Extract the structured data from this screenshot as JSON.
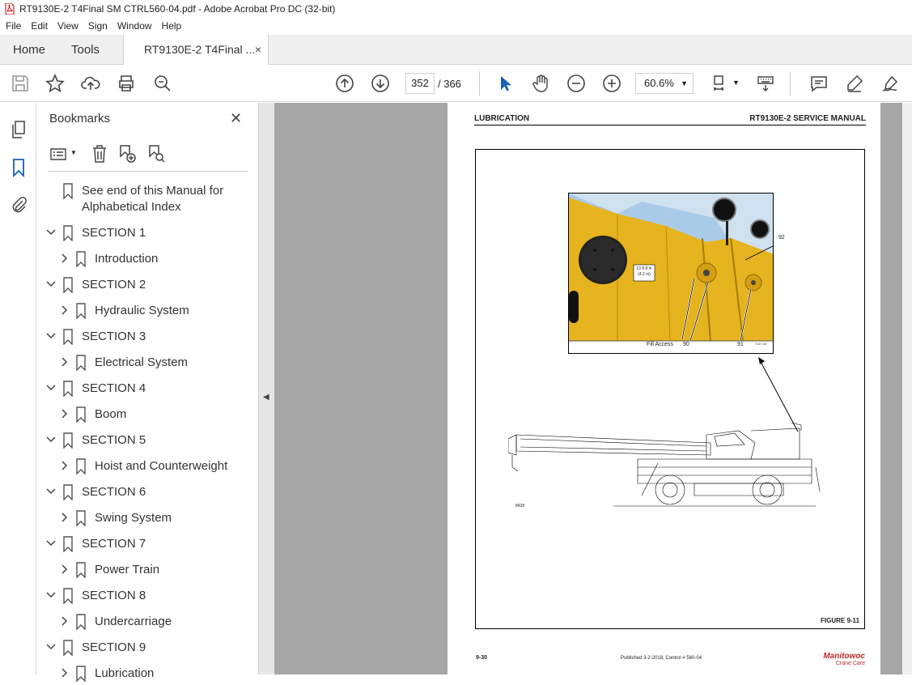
{
  "window": {
    "title": "RT9130E-2 T4Final SM CTRL560-04.pdf - Adobe Acrobat Pro DC (32-bit)"
  },
  "menu": [
    "File",
    "Edit",
    "View",
    "Sign",
    "Window",
    "Help"
  ],
  "tabs": {
    "home": "Home",
    "tools": "Tools",
    "doc": "RT9130E-2 T4Final ...",
    "close": "×"
  },
  "nav": {
    "page": "352",
    "total": "/ 366",
    "zoom": "60.6%"
  },
  "bookmarks": {
    "title": "Bookmarks",
    "items": [
      {
        "label": "See end of this Manual for",
        "label2": "Alphabetical Index",
        "level": 0,
        "chev": "none"
      },
      {
        "label": "SECTION 1",
        "level": 0,
        "chev": "down"
      },
      {
        "label": "Introduction",
        "level": 1,
        "chev": "right"
      },
      {
        "label": "SECTION 2",
        "level": 0,
        "chev": "down"
      },
      {
        "label": "Hydraulic System",
        "level": 1,
        "chev": "right"
      },
      {
        "label": "SECTION 3",
        "level": 0,
        "chev": "down"
      },
      {
        "label": "Electrical System",
        "level": 1,
        "chev": "right"
      },
      {
        "label": "SECTION 4",
        "level": 0,
        "chev": "down"
      },
      {
        "label": "Boom",
        "level": 1,
        "chev": "right"
      },
      {
        "label": "SECTION 5",
        "level": 0,
        "chev": "down"
      },
      {
        "label": "Hoist and Counterweight",
        "level": 1,
        "chev": "right"
      },
      {
        "label": "SECTION 6",
        "level": 0,
        "chev": "down"
      },
      {
        "label": "Swing System",
        "level": 1,
        "chev": "right"
      },
      {
        "label": "SECTION 7",
        "level": 0,
        "chev": "down"
      },
      {
        "label": "Power Train",
        "level": 1,
        "chev": "right"
      },
      {
        "label": "SECTION 8",
        "level": 0,
        "chev": "down"
      },
      {
        "label": "Undercarriage",
        "level": 1,
        "chev": "right"
      },
      {
        "label": "SECTION 9",
        "level": 0,
        "chev": "down"
      },
      {
        "label": "Lubrication",
        "level": 1,
        "chev": "right"
      }
    ]
  },
  "pdfpage": {
    "header_left": "LUBRICATION",
    "header_right": "RT9130E-2 SERVICE MANUAL",
    "measure1": "13 ft 8 in",
    "measure2": "(4.2 m)",
    "callout_92": "92",
    "callout_fill": "Fill Access",
    "callout_90": "90",
    "callout_91": "91",
    "photo_code": "7117-16",
    "drawing_code": "8428",
    "figure": "FIGURE 9-11",
    "footer_page": "9-30",
    "footer_pub": "Published 3-2-2018, Control # 560-04",
    "brand": "Manitowoc",
    "brand_sub": "Crane Care"
  },
  "colors": {
    "accent": "#1a5fb4",
    "yellow": "#e6b41e"
  }
}
